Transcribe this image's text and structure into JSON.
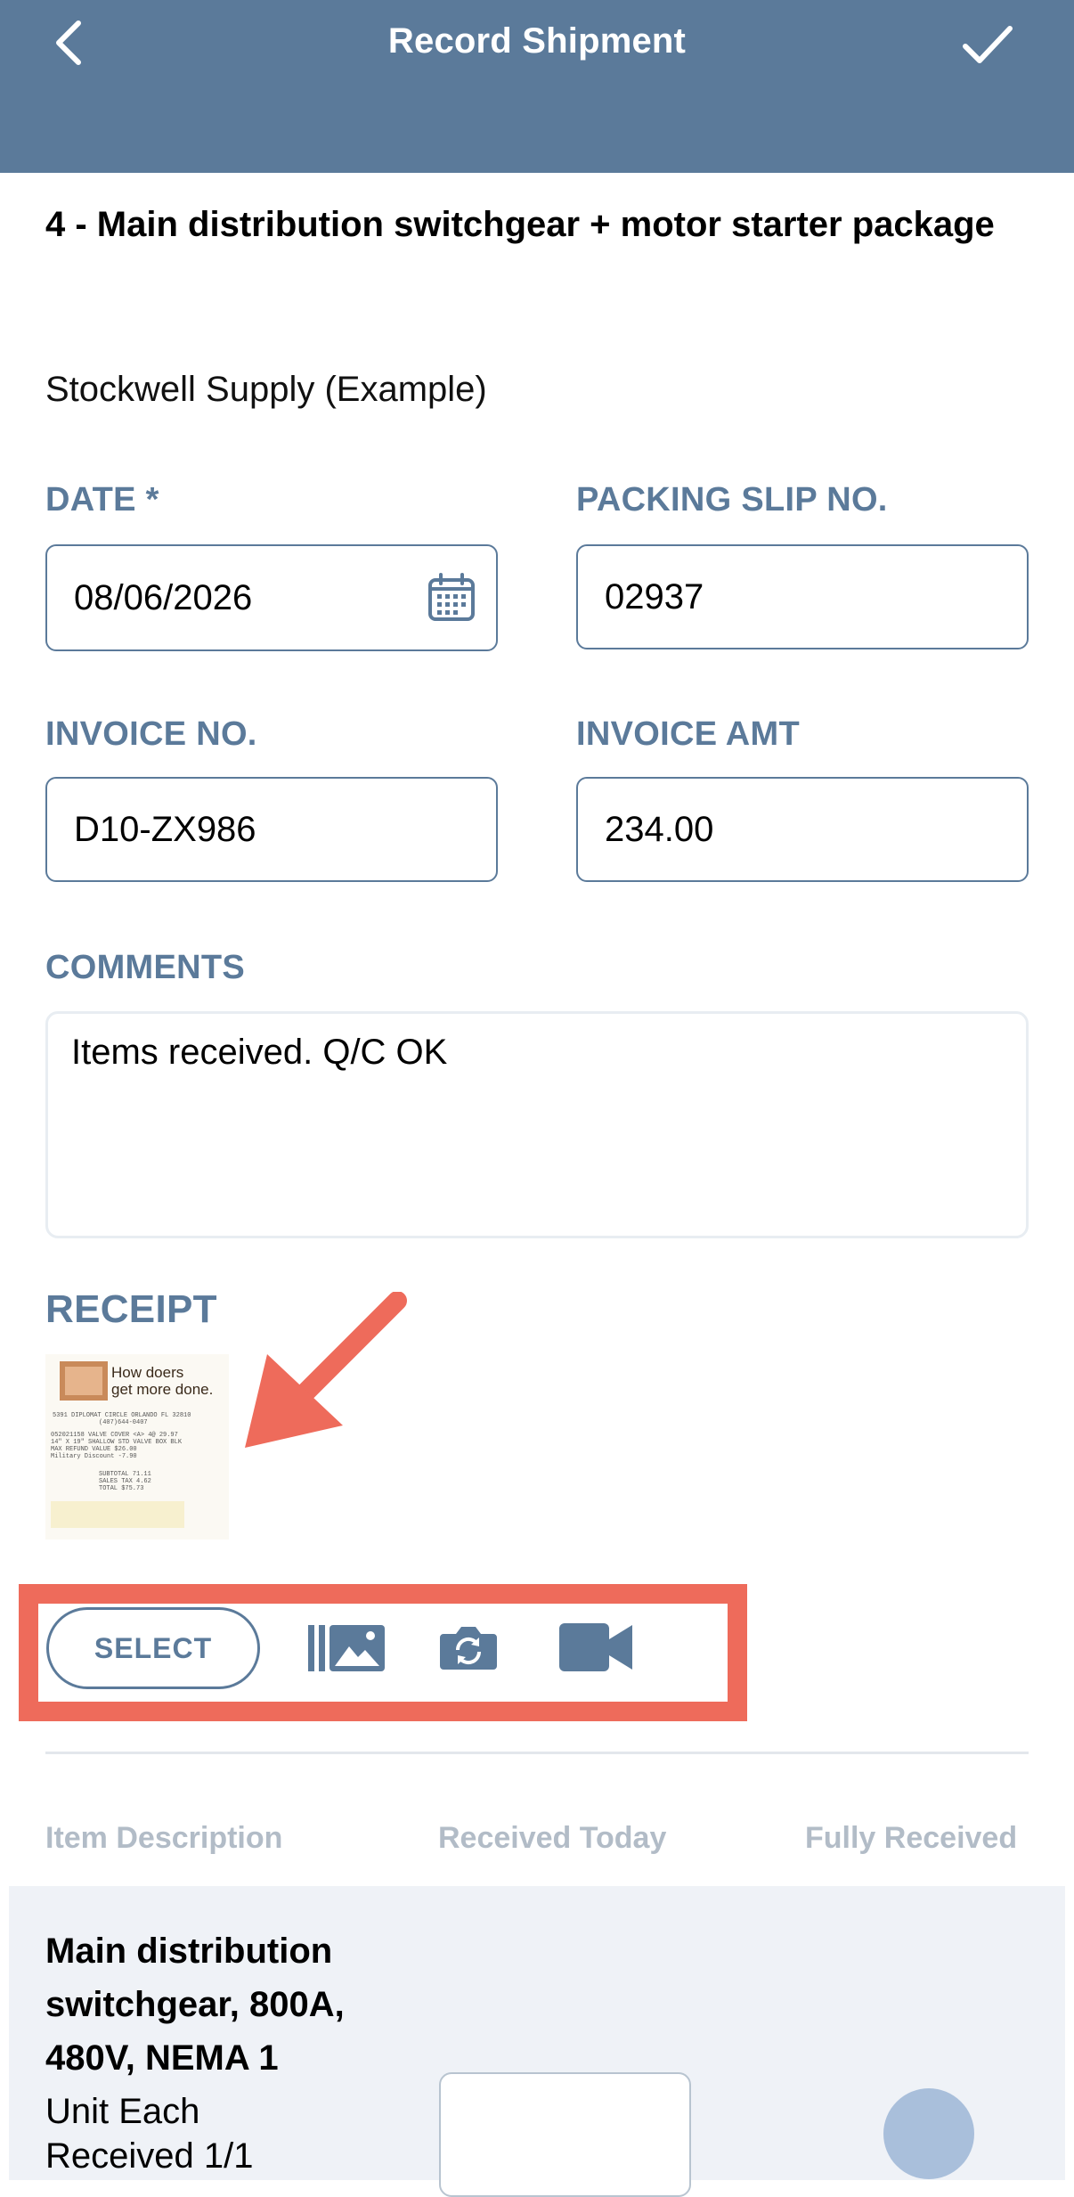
{
  "header": {
    "title": "Record Shipment"
  },
  "job": {
    "title": "4 - Main distribution switchgear + motor starter package",
    "vendor": "Stockwell Supply (Example)"
  },
  "form": {
    "date": {
      "label": "DATE *",
      "value": "08/06/2026"
    },
    "packing_slip": {
      "label": "PACKING SLIP NO.",
      "value": "02937"
    },
    "invoice_no": {
      "label": "INVOICE NO.",
      "value": "D10-ZX986"
    },
    "invoice_amt": {
      "label": "INVOICE AMT",
      "value": "234.00"
    },
    "comments": {
      "label": "COMMENTS",
      "value": "Items received. Q/C OK"
    }
  },
  "receipt": {
    "label": "RECEIPT",
    "thumb_lines": {
      "brand_line1": "How doers",
      "brand_line2": "get more done.",
      "address": "5391 DIPLOMAT CIRCLE ORLANDO FL 32810",
      "phone": "(407)644-0407",
      "item1": "052021158 VALVE COVER <A> 4@ 29.97",
      "item2": "14\" X 19\" SHALLOW STD VALVE BOX BLK",
      "item3": "MAX REFUND VALUE $26.00",
      "item4": "Military Discount -7.90",
      "subtotal": "SUBTOTAL 71.11",
      "tax": "SALES TAX 4.62",
      "total": "TOTAL $75.73"
    }
  },
  "attach": {
    "select_label": "SELECT"
  },
  "table": {
    "columns": [
      "Item Description",
      "Received Today",
      "Fully Received"
    ],
    "rows": [
      {
        "name": "Main distribution switchgear, 800A, 480V, NEMA 1",
        "unit": "Unit Each",
        "received": "Received 1/1",
        "received_today": ""
      }
    ]
  },
  "colors": {
    "header": "#5b7a9a",
    "accent": "#5b7a9a",
    "highlight": "#ee6b5b",
    "row_bg": "#eff2f7"
  }
}
